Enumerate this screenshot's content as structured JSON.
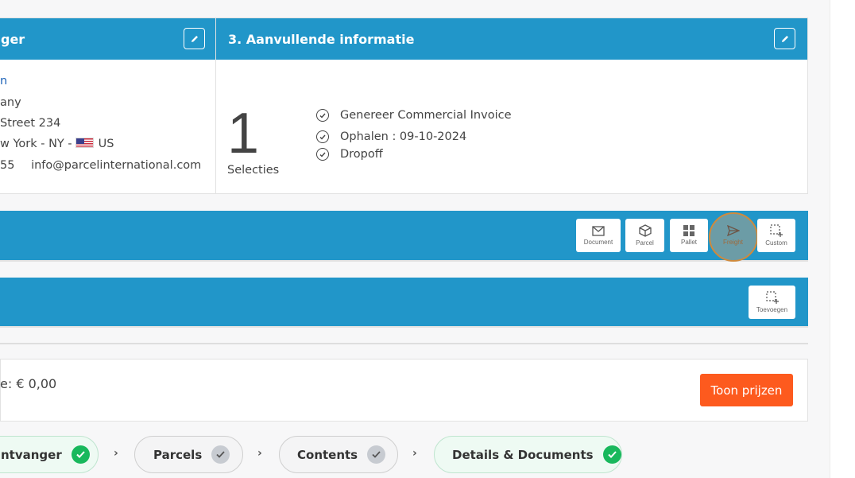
{
  "receiver_card": {
    "title_fragment": "ger",
    "name_fragment": "n",
    "company_fragment": "any",
    "street_fragment": "Street 234",
    "city_fragment": "w York - NY -",
    "country": "US",
    "phone_fragment": "55",
    "email": "info@parcelinternational.com"
  },
  "info_card": {
    "title": "3. Aanvullende informatie",
    "selection_count": "1",
    "selection_label": "Selecties",
    "checks": [
      "Genereer Commercial Invoice",
      "Ophalen : 09-10-2024",
      "Dropoff"
    ]
  },
  "type_bar": {
    "buttons": [
      {
        "label": "Document",
        "icon": "envelope-icon"
      },
      {
        "label": "Parcel",
        "icon": "box-icon"
      },
      {
        "label": "Pallet",
        "icon": "grid-icon"
      },
      {
        "label": "Freight",
        "icon": "send-icon"
      },
      {
        "label": "Custom",
        "icon": "dashed-square-plus-icon"
      }
    ],
    "highlighted": "Freight",
    "highlight_color": "#d08a3c"
  },
  "add_bar": {
    "add_label": "Toevoegen"
  },
  "price": {
    "text_fragment": "e: € 0,00",
    "button_label": "Toon prijzen",
    "button_color": "#fd5a1e"
  },
  "steps": [
    {
      "label": "ntvanger",
      "status": "done"
    },
    {
      "label": "Parcels",
      "status": "pending"
    },
    {
      "label": "Contents",
      "status": "pending"
    },
    {
      "label": "Details & Documents",
      "status": "done"
    }
  ],
  "colors": {
    "primary": "#2196c9",
    "success": "#18b85c",
    "accent": "#fd5a1e"
  }
}
